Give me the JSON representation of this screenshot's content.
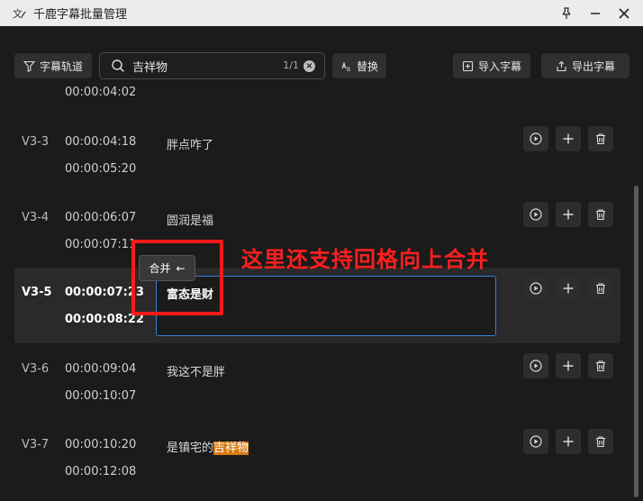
{
  "window": {
    "title": "千鹿字幕批量管理",
    "app_icon": "app-logo-icon",
    "buttons": [
      "pin-icon",
      "minimize-icon",
      "close-icon"
    ]
  },
  "toolbar": {
    "track_label": "字幕轨道",
    "search_value": "吉祥物",
    "search_count": "1/1",
    "replace_label": "替换",
    "import_label": "导入字幕",
    "export_label": "导出字幕"
  },
  "partial_top_time": "00:00:04:02",
  "rows": [
    {
      "id": "V3-3",
      "start": "00:00:04:18",
      "end": "00:00:05:20",
      "text": "胖点咋了"
    },
    {
      "id": "V3-4",
      "start": "00:00:06:07",
      "end": "00:00:07:11",
      "text": "圆润是福"
    },
    {
      "id": "V3-5",
      "start": "00:00:07:23",
      "end": "00:00:08:22",
      "text": "富态是财"
    },
    {
      "id": "V3-6",
      "start": "00:00:09:04",
      "end": "00:00:10:07",
      "text": "我这不是胖"
    },
    {
      "id": "V3-7",
      "start": "00:00:10:20",
      "end": "00:00:12:08",
      "text_before": "是镇宅的",
      "text_highlight": "吉祥物"
    }
  ],
  "merge_tooltip": {
    "label": "合并",
    "arrow": "←"
  },
  "annotation": "这里还支持回格向上合并",
  "colors": {
    "highlight": "#d77a14",
    "annotation": "#ff1f1f",
    "focus_border": "#3b7ddd"
  }
}
